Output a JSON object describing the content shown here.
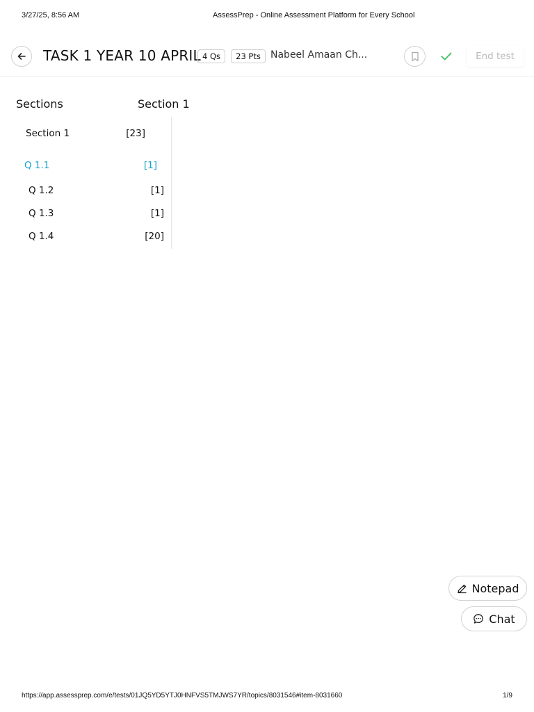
{
  "print_header": {
    "datetime": "3/27/25, 8:56 AM",
    "page_title": "AssessPrep - Online Assessment Platform for Every School"
  },
  "topbar": {
    "test_title": "TASK 1 YEAR 10 APRIL",
    "questions_pill": "4 Qs",
    "points_pill": "23 Pts",
    "student_name": "Nabeel Amaan Ch...",
    "end_test_label": "End test",
    "icons": {
      "back": "arrow-left-icon",
      "bookmark": "bookmark-icon",
      "status": "check-icon"
    }
  },
  "sections_heading": "Sections",
  "current_section_heading": "Section 1",
  "nav": {
    "section": {
      "label": "Section 1",
      "points": "[23]"
    },
    "questions": [
      {
        "label": "Q 1.1",
        "points": "[1]",
        "active": true
      },
      {
        "label": "Q 1.2",
        "points": "[1]",
        "active": false
      },
      {
        "label": "Q 1.3",
        "points": "[1]",
        "active": false
      },
      {
        "label": "Q 1.4",
        "points": "[20]",
        "active": false
      }
    ]
  },
  "floating": {
    "notepad_label": "Notepad",
    "chat_label": "Chat"
  },
  "print_footer": {
    "url": "https://app.assessprep.com/e/tests/01JQ5YD5YTJ0HNFVS5TMJWS7YR/topics/8031546#item-8031660",
    "page": "1/9"
  },
  "colors": {
    "accent": "#17a2c9",
    "check": "#3cc15f",
    "disabled_text": "#b9b9b9",
    "border": "#cfcfcf"
  }
}
